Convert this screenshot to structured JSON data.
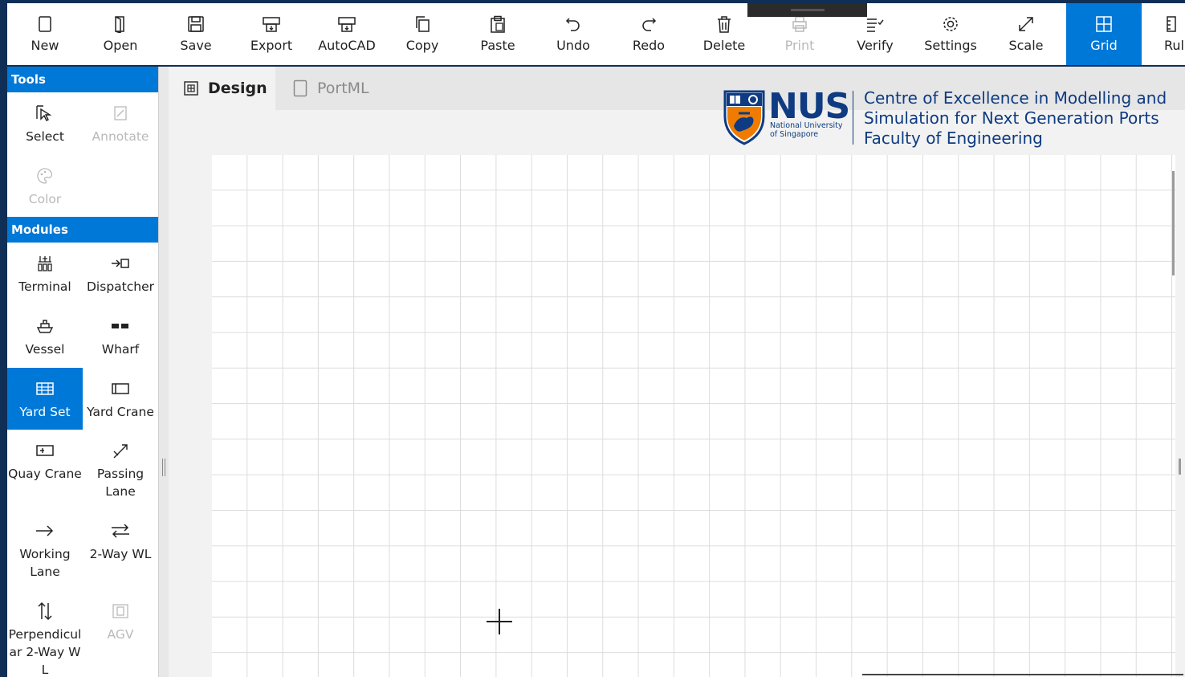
{
  "toolbar": {
    "buttons": [
      {
        "label": "New",
        "icon": "new-file-icon",
        "state": "normal"
      },
      {
        "label": "Open",
        "icon": "open-file-icon",
        "state": "normal"
      },
      {
        "label": "Save",
        "icon": "save-icon",
        "state": "normal"
      },
      {
        "label": "Export",
        "icon": "export-icon",
        "state": "normal"
      },
      {
        "label": "AutoCAD",
        "icon": "autocad-icon",
        "state": "normal"
      },
      {
        "label": "Copy",
        "icon": "copy-icon",
        "state": "normal"
      },
      {
        "label": "Paste",
        "icon": "paste-icon",
        "state": "normal"
      },
      {
        "label": "Undo",
        "icon": "undo-icon",
        "state": "normal"
      },
      {
        "label": "Redo",
        "icon": "redo-icon",
        "state": "normal"
      },
      {
        "label": "Delete",
        "icon": "delete-icon",
        "state": "normal"
      },
      {
        "label": "Print",
        "icon": "print-icon",
        "state": "disabled"
      },
      {
        "label": "Verify",
        "icon": "verify-icon",
        "state": "normal"
      },
      {
        "label": "Settings",
        "icon": "gear-icon",
        "state": "normal"
      },
      {
        "label": "Scale",
        "icon": "scale-icon",
        "state": "normal"
      },
      {
        "label": "Grid",
        "icon": "grid-icon",
        "state": "active"
      },
      {
        "label": "Rul",
        "icon": "ruler-icon",
        "state": "normal"
      }
    ]
  },
  "sidebar": {
    "tools_header": "Tools",
    "modules_header": "Modules",
    "tools": [
      {
        "label": "Select",
        "icon": "select-pointer-icon",
        "state": "normal"
      },
      {
        "label": "Annotate",
        "icon": "annotate-icon",
        "state": "disabled"
      },
      {
        "label": "Color",
        "icon": "palette-icon",
        "state": "disabled"
      }
    ],
    "modules": [
      {
        "label": "Terminal",
        "icon": "terminal-icon",
        "state": "normal"
      },
      {
        "label": "Dispatcher",
        "icon": "dispatcher-icon",
        "state": "normal"
      },
      {
        "label": "Vessel",
        "icon": "vessel-icon",
        "state": "normal"
      },
      {
        "label": "Wharf",
        "icon": "wharf-icon",
        "state": "normal"
      },
      {
        "label": "Yard Set",
        "icon": "yard-set-icon",
        "state": "active"
      },
      {
        "label": "Yard Crane",
        "icon": "yard-crane-icon",
        "state": "normal"
      },
      {
        "label": "Quay Crane",
        "icon": "quay-crane-icon",
        "state": "normal"
      },
      {
        "label": "Passing Lane",
        "icon": "passing-lane-icon",
        "state": "normal"
      },
      {
        "label": "Working Lane",
        "icon": "working-lane-icon",
        "state": "normal"
      },
      {
        "label": "2-Way WL",
        "icon": "two-way-arrows-icon",
        "state": "normal"
      },
      {
        "label": "Perpendicular 2-Way WL",
        "icon": "perpendicular-arrows-icon",
        "state": "normal"
      },
      {
        "label": "AGV",
        "icon": "agv-icon",
        "state": "disabled"
      }
    ]
  },
  "tabs": [
    {
      "label": "Design",
      "icon": "design-grid-icon",
      "selected": true
    },
    {
      "label": "PortML",
      "icon": "document-icon",
      "selected": false
    }
  ],
  "logo": {
    "wordmark": "NUS",
    "university_line1": "National University",
    "university_line2": "of Singapore",
    "centre_line1": "Centre of Excellence in Modelling and",
    "centre_line2": "Simulation for Next Generation Ports",
    "centre_line3": "Faculty of Engineering"
  },
  "colors": {
    "accent": "#0078d7",
    "frame": "#0f2f57",
    "nus_blue": "#0e3b81",
    "nus_orange": "#ef7c00"
  }
}
